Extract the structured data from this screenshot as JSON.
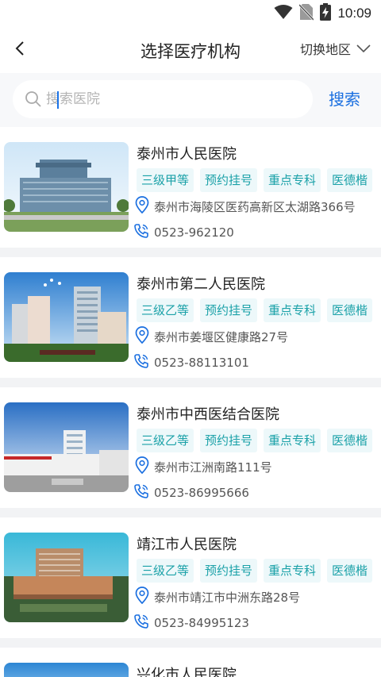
{
  "status_bar": {
    "time": "10:09"
  },
  "header": {
    "title": "选择医疗机构",
    "region_label": "切换地区"
  },
  "search": {
    "placeholder": "搜索医院",
    "button_label": "搜索"
  },
  "hospitals": [
    {
      "name": "泰州市人民医院",
      "tags": [
        "三级甲等",
        "预约挂号",
        "重点专科",
        "医德楷"
      ],
      "address": "泰州市海陵区医药高新区太湖路366号",
      "phone": "0523-962120"
    },
    {
      "name": "泰州市第二人民医院",
      "tags": [
        "三级乙等",
        "预约挂号",
        "重点专科",
        "医德楷"
      ],
      "address": "泰州市姜堰区健康路27号",
      "phone": "0523-88113101"
    },
    {
      "name": "泰州市中西医结合医院",
      "tags": [
        "三级乙等",
        "预约挂号",
        "重点专科",
        "医德楷"
      ],
      "address": "泰州市江洲南路111号",
      "phone": "0523-86995666"
    },
    {
      "name": "靖江市人民医院",
      "tags": [
        "三级乙等",
        "预约挂号",
        "重点专科",
        "医德楷"
      ],
      "address": "泰州市靖江市中洲东路28号",
      "phone": "0523-84995123"
    },
    {
      "name": "兴化市人民医院"
    }
  ],
  "colors": {
    "accent": "#1a6fe0",
    "tag_text": "#1aa1a8",
    "tag_bg": "#edf8fa",
    "page_bg": "#f2f3f5"
  }
}
